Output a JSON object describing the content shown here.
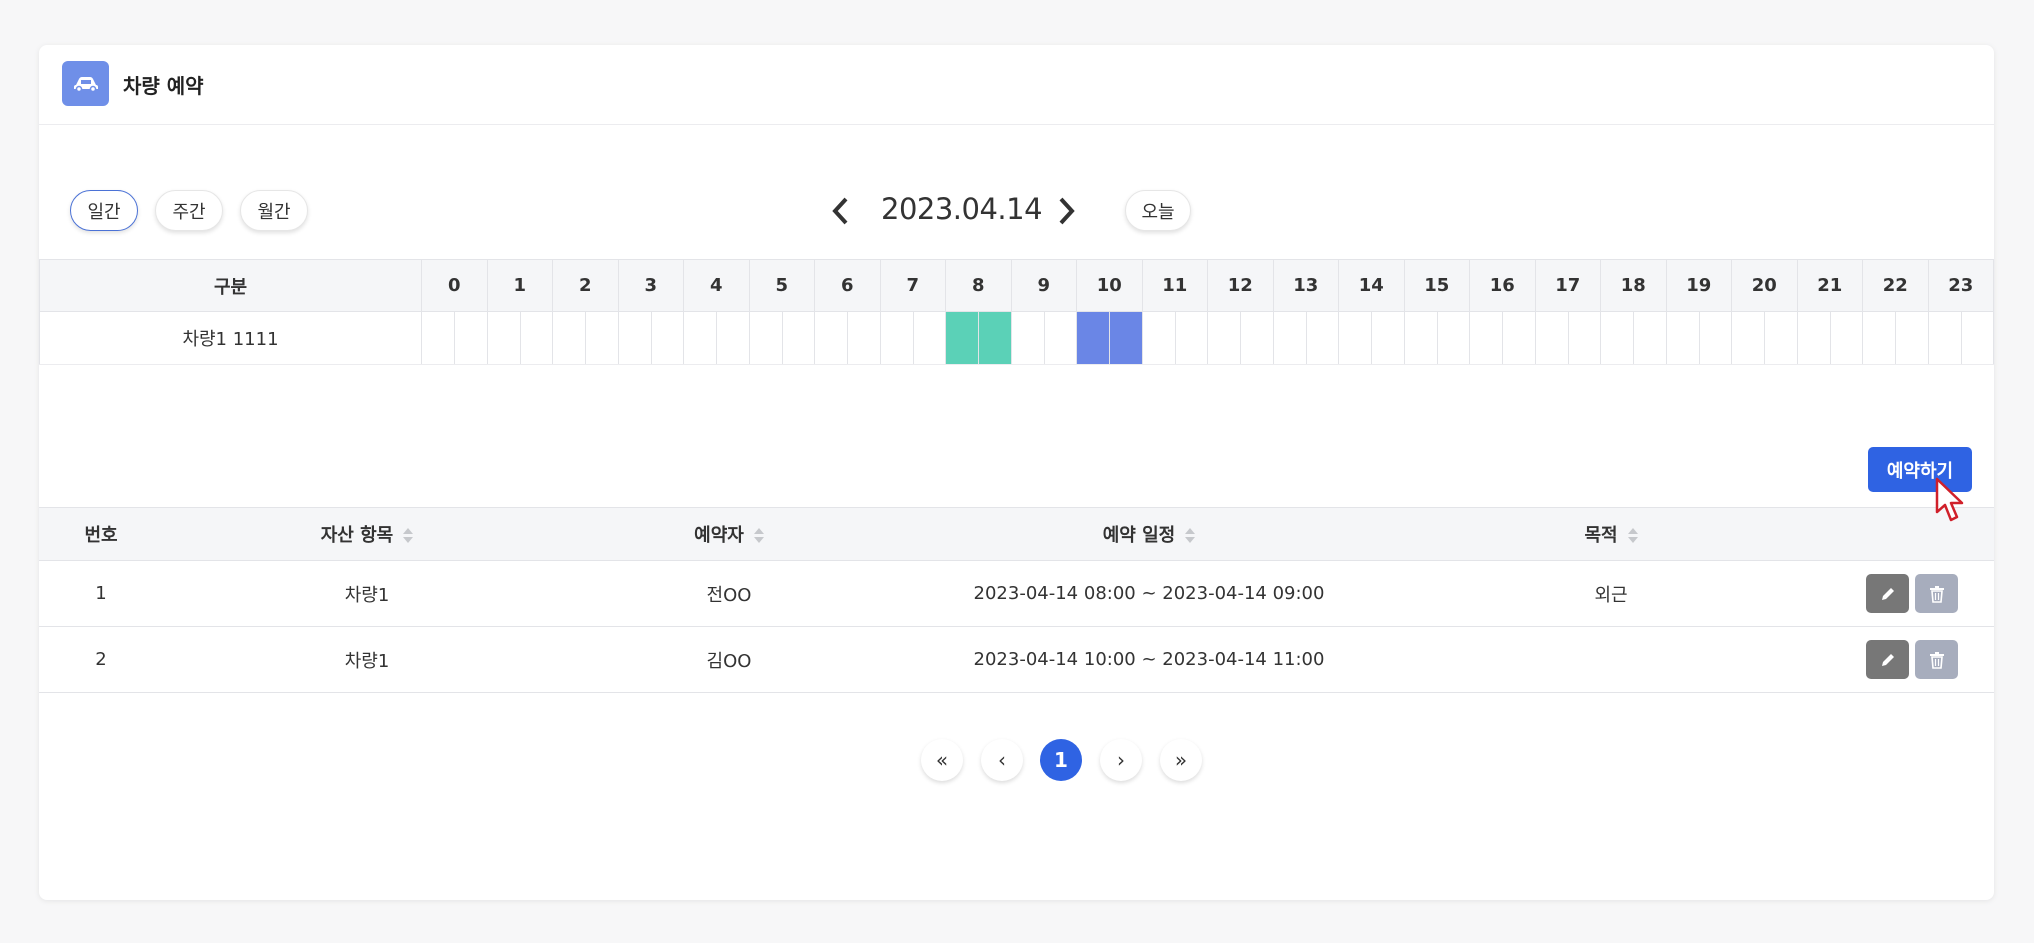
{
  "header": {
    "title": "차량 예약",
    "icon": "car-icon"
  },
  "views": [
    "일간",
    "주간",
    "월간"
  ],
  "active_view": "일간",
  "date_nav": {
    "date": "2023.04.14",
    "today_label": "오늘"
  },
  "timeline": {
    "category_header": "구분",
    "hours": [
      "0",
      "1",
      "2",
      "3",
      "4",
      "5",
      "6",
      "7",
      "8",
      "9",
      "10",
      "11",
      "12",
      "13",
      "14",
      "15",
      "16",
      "17",
      "18",
      "19",
      "20",
      "21",
      "22",
      "23"
    ],
    "row_label": "차량1 1111",
    "bookings": [
      {
        "start": "08:00",
        "end": "09:00",
        "color": "#5bd1b7"
      },
      {
        "start": "10:00",
        "end": "11:00",
        "color": "#6a86e6"
      }
    ]
  },
  "reserve_button": "예약하기",
  "table": {
    "headers": {
      "no": "번호",
      "asset": "자산 항목",
      "reserver": "예약자",
      "schedule": "예약 일정",
      "purpose": "목적"
    },
    "rows": [
      {
        "no": "1",
        "asset": "차량1",
        "reserver": "전OO",
        "schedule": "2023-04-14 08:00 ~ 2023-04-14 09:00",
        "purpose": "외근"
      },
      {
        "no": "2",
        "asset": "차량1",
        "reserver": "김OO",
        "schedule": "2023-04-14 10:00 ~ 2023-04-14 11:00",
        "purpose": ""
      }
    ]
  },
  "pagination": {
    "first": "«",
    "prev": "‹",
    "current": "1",
    "next": "›",
    "last": "»"
  }
}
